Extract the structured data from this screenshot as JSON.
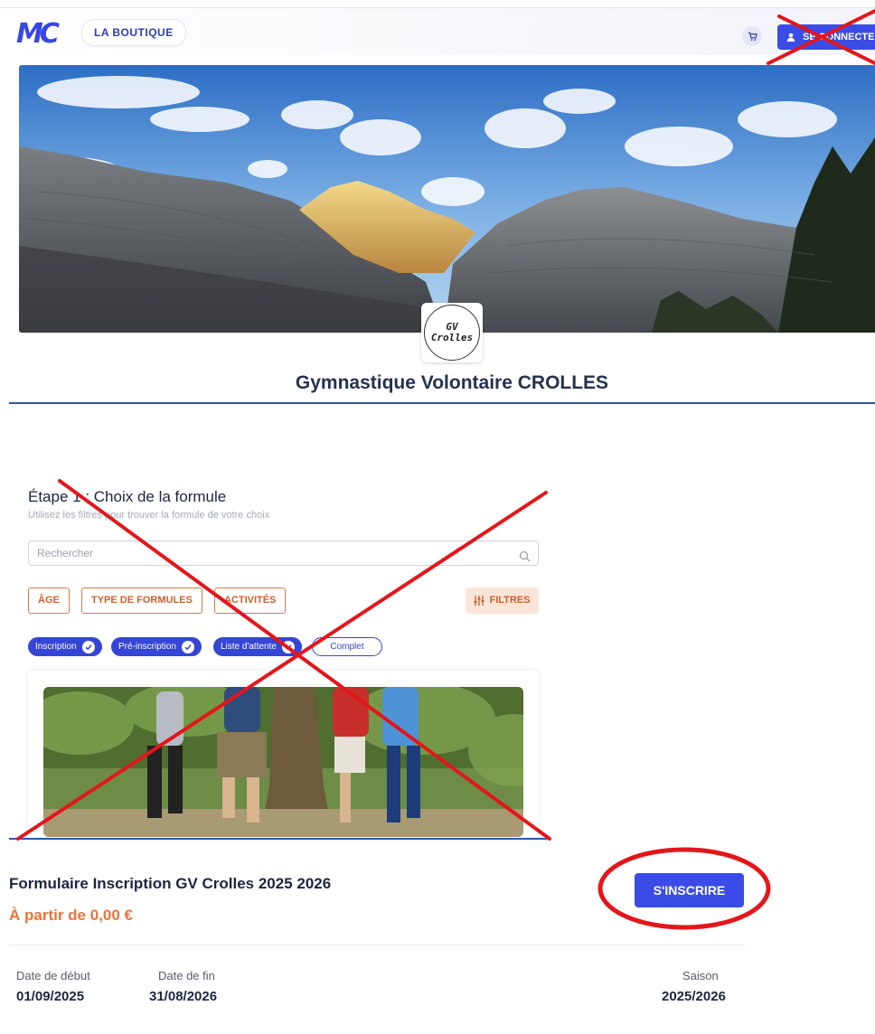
{
  "header": {
    "logo_text": "MC",
    "boutique_label": "LA BOUTIQUE",
    "login_label": "SE CONNECTER"
  },
  "club": {
    "logo_line1": "GV",
    "logo_line2": "Crolles",
    "name": "Gymnastique Volontaire CROLLES"
  },
  "step": {
    "title": "Étape 1 : Choix de la formule",
    "subtitle": "Utilisez les filtres pour trouver la formule de votre choix",
    "search_placeholder": "Rechercher",
    "filter_buttons": [
      "ÂGE",
      "TYPE DE FORMULES",
      "ACTIVITÉS"
    ],
    "filters_label": "FILTRES",
    "chips": [
      {
        "label": "Inscription",
        "selected": true
      },
      {
        "label": "Pré-inscription",
        "selected": true
      },
      {
        "label": "Liste d'attente",
        "selected": true
      },
      {
        "label": "Complet",
        "selected": false
      }
    ]
  },
  "formula": {
    "title": "Formulaire Inscription GV Crolles 2025 2026",
    "price": "À partir de 0,00 €",
    "cta_label": "S'INSCRIRE",
    "start_label": "Date de début",
    "start_value": "01/09/2025",
    "end_label": "Date de fin",
    "end_value": "31/08/2026",
    "season_label": "Saison",
    "season_value": "2025/2026"
  },
  "colors": {
    "brand_blue": "#3b4ce6",
    "accent_orange": "#e8743a",
    "annotation_red": "#e3161b"
  }
}
